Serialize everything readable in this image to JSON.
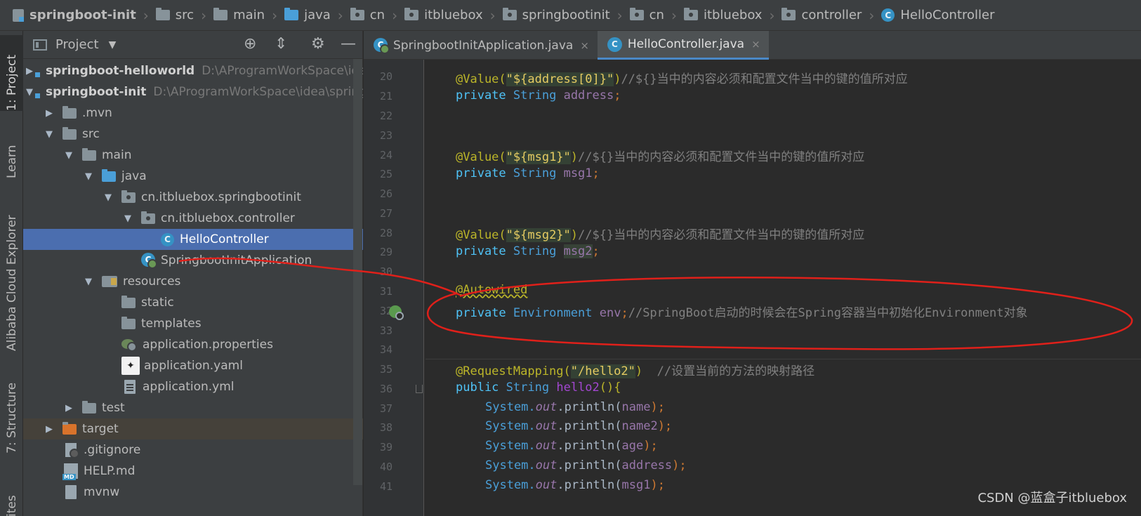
{
  "breadcrumb": [
    "springboot-init",
    "src",
    "main",
    "java",
    "cn",
    "itbluebox",
    "springbootinit",
    "cn",
    "itbluebox",
    "controller",
    "HelloController"
  ],
  "toolstrip": {
    "project": "1: Project",
    "learn": "Learn",
    "alibaba": "Alibaba Cloud Explorer",
    "structure": "7: Structure",
    "favorites": "ites"
  },
  "project_panel": {
    "title": "Project",
    "tree": [
      {
        "label": "springboot-helloworld",
        "path": "D:\\AProgramWorkSpace\\idea\\"
      },
      {
        "label": "springboot-init",
        "path": "D:\\AProgramWorkSpace\\idea\\springb"
      },
      {
        "label": ".mvn"
      },
      {
        "label": "src"
      },
      {
        "label": "main"
      },
      {
        "label": "java"
      },
      {
        "label": "cn.itbluebox.springbootinit"
      },
      {
        "label": "cn.itbluebox.controller"
      },
      {
        "label": "HelloController"
      },
      {
        "label": "SpringbootInitApplication"
      },
      {
        "label": "resources"
      },
      {
        "label": "static"
      },
      {
        "label": "templates"
      },
      {
        "label": "application.properties"
      },
      {
        "label": "application.yaml"
      },
      {
        "label": "application.yml"
      },
      {
        "label": "test"
      },
      {
        "label": "target"
      },
      {
        "label": ".gitignore"
      },
      {
        "label": "HELP.md"
      },
      {
        "label": "mvnw"
      }
    ]
  },
  "tabs": [
    {
      "label": "SpringbootInitApplication.java",
      "close": "×"
    },
    {
      "label": "HelloController.java",
      "close": "×"
    }
  ],
  "editor": {
    "line_numbers": [
      "20",
      "21",
      "22",
      "23",
      "24",
      "25",
      "26",
      "27",
      "28",
      "29",
      "30",
      "31",
      "32",
      "33",
      "34",
      "35",
      "36",
      "37",
      "38",
      "39",
      "40",
      "41"
    ],
    "lines": {
      "l20": {
        "ann": "@Value(",
        "str": "\"${address[0]}\"",
        "close": ")",
        "cmt": "//${}当中的内容必须和配置文件当中的键的值所对应"
      },
      "l21": {
        "kw": "private",
        "type": "String",
        "field": "address",
        "end": ";"
      },
      "l24": {
        "ann": "@Value(",
        "str": "\"${msg1}\"",
        "close": ")",
        "cmt": "//${}当中的内容必须和配置文件当中的键的值所对应"
      },
      "l25": {
        "kw": "private",
        "type": "String",
        "field": "msg1",
        "end": ";"
      },
      "l28": {
        "ann": "@Value(",
        "str": "\"${msg2}\"",
        "close": ")",
        "cmt": "//${}当中的内容必须和配置文件当中的键的值所对应"
      },
      "l29": {
        "kw": "private",
        "type": "String",
        "field": "msg2",
        "end": ";"
      },
      "l31": {
        "ann": "@Autowired"
      },
      "l32": {
        "kw": "private",
        "type": "Environment",
        "field": "env",
        "end": ";",
        "cmt": "//SpringBoot启动的时候会在Spring容器当中初始化Environment对象"
      },
      "l35": {
        "ann": "@RequestMapping(",
        "str": "\"/hello2\"",
        "close": ")",
        "cmt": "//设置当前的方法的映射路径"
      },
      "l36": {
        "kw": "public",
        "type": "String",
        "fn": "hello2",
        "end": "(){"
      },
      "l37": {
        "cls": "System.",
        "out": "out",
        "call": ".println(",
        "arg": "name",
        "end": ");"
      },
      "l38": {
        "cls": "System.",
        "out": "out",
        "call": ".println(",
        "arg": "name2",
        "end": ");"
      },
      "l39": {
        "cls": "System.",
        "out": "out",
        "call": ".println(",
        "arg": "age",
        "end": ");"
      },
      "l40": {
        "cls": "System.",
        "out": "out",
        "call": ".println(",
        "arg": "address",
        "end": ");"
      },
      "l41": {
        "cls": "System.",
        "out": "out",
        "call": ".println(",
        "arg": "msg1",
        "end": ");"
      }
    }
  },
  "watermark": "CSDN @蓝盒子itbluebox",
  "colors": {
    "annotation_circle": "#e0201a",
    "selection": "#4b6eaf",
    "tab_underline": "#4a88c7"
  }
}
